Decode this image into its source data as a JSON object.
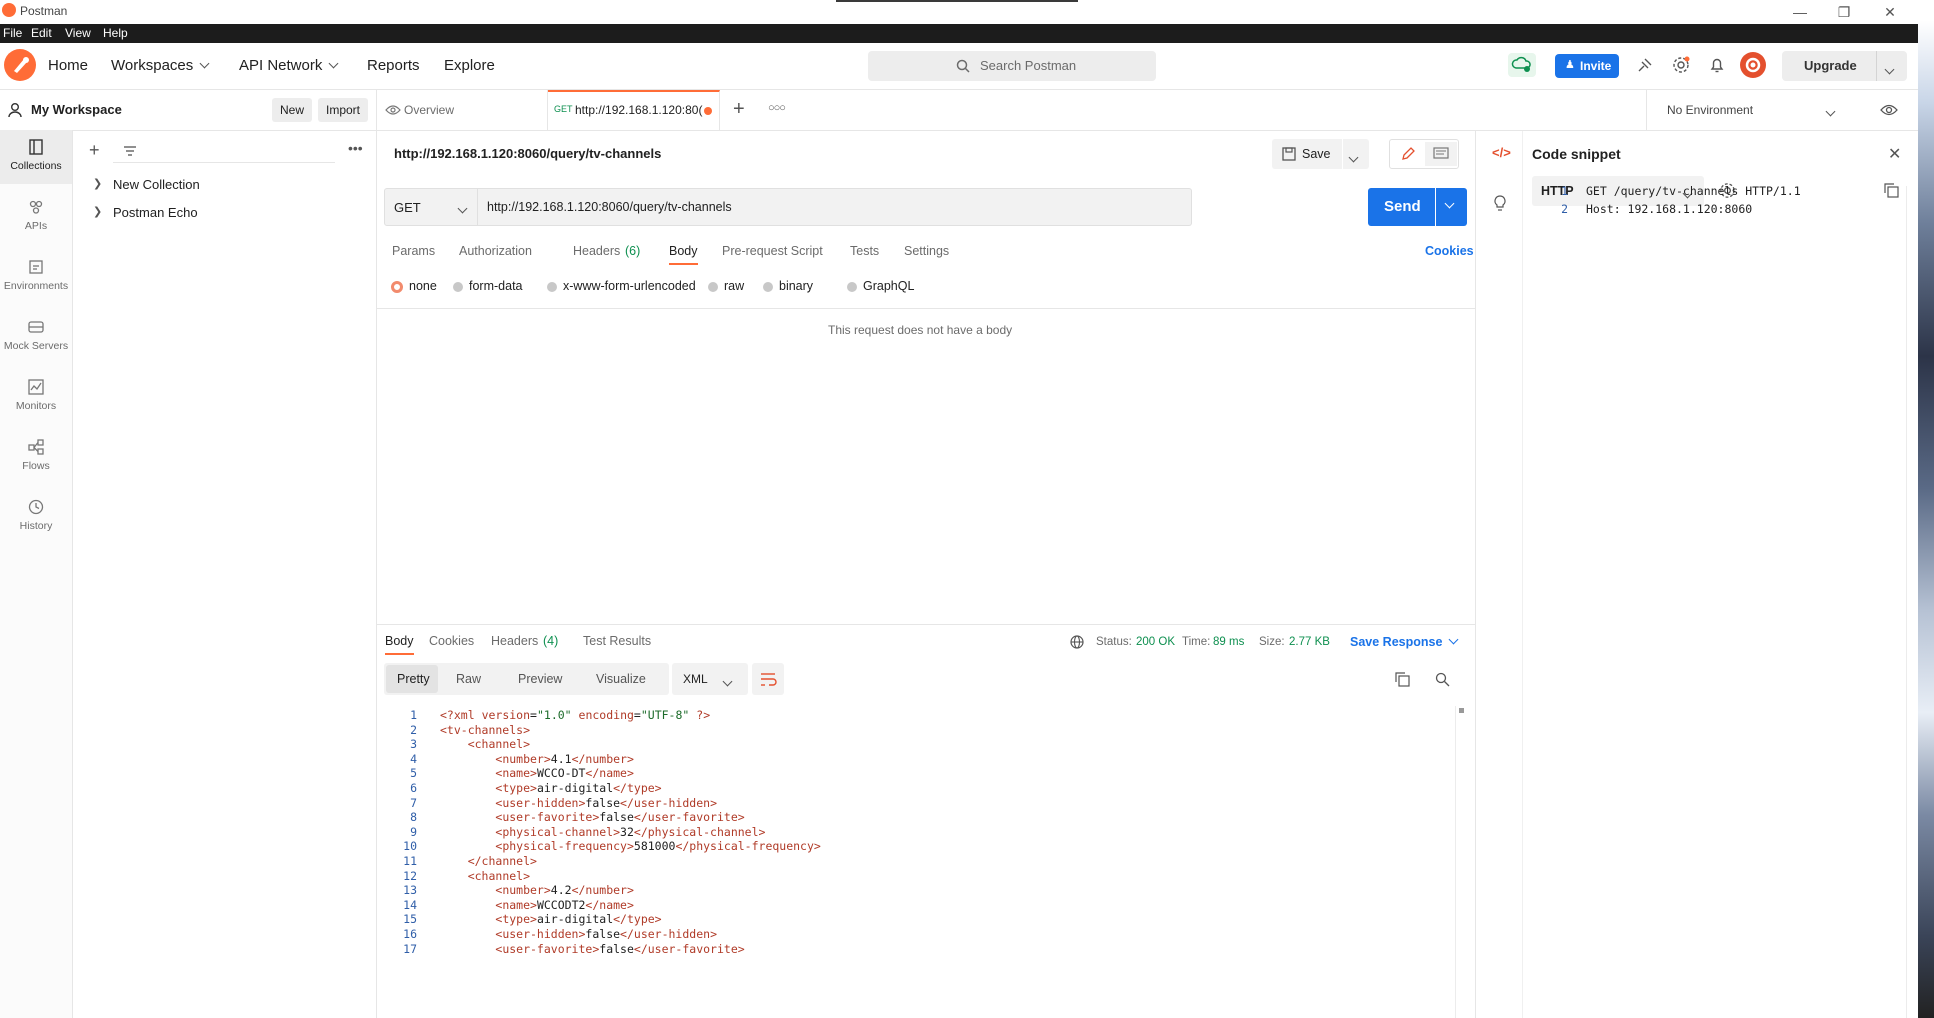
{
  "window": {
    "title": "Postman"
  },
  "menu": [
    "File",
    "Edit",
    "View",
    "Help"
  ],
  "header": {
    "nav": [
      "Home",
      "Workspaces",
      "API Network",
      "Reports",
      "Explore"
    ],
    "search_placeholder": "Search Postman",
    "invite_label": "Invite",
    "upgrade_label": "Upgrade"
  },
  "workspace": {
    "name": "My Workspace",
    "new_label": "New",
    "import_label": "Import"
  },
  "rail": [
    {
      "label": "Collections",
      "icon": "collections-icon"
    },
    {
      "label": "APIs",
      "icon": "apis-icon"
    },
    {
      "label": "Environments",
      "icon": "environments-icon"
    },
    {
      "label": "Mock Servers",
      "icon": "mock-servers-icon"
    },
    {
      "label": "Monitors",
      "icon": "monitors-icon"
    },
    {
      "label": "Flows",
      "icon": "flows-icon"
    },
    {
      "label": "History",
      "icon": "history-icon"
    }
  ],
  "collections": [
    "New Collection",
    "Postman Echo"
  ],
  "tabs": {
    "overview": "Overview",
    "active_method": "GET",
    "active_url": "http://192.168.1.120:80(",
    "environment": "No Environment"
  },
  "request": {
    "title": "http://192.168.1.120:8060/query/tv-channels",
    "save_label": "Save",
    "method": "GET",
    "url": "http://192.168.1.120:8060/query/tv-channels",
    "send_label": "Send",
    "tabs": [
      "Params",
      "Authorization",
      "Headers",
      "(6)",
      "Body",
      "Pre-request Script",
      "Tests",
      "Settings"
    ],
    "cookies_label": "Cookies",
    "body_types": [
      "none",
      "form-data",
      "x-www-form-urlencoded",
      "raw",
      "binary",
      "GraphQL"
    ],
    "no_body_message": "This request does not have a body"
  },
  "response": {
    "tabs": [
      "Body",
      "Cookies",
      "Headers",
      "(4)",
      "Test Results"
    ],
    "status_label": "Status:",
    "status_value": "200 OK",
    "time_label": "Time:",
    "time_value": "89 ms",
    "size_label": "Size:",
    "size_value": "2.77 KB",
    "save_response_label": "Save Response",
    "view_modes": [
      "Pretty",
      "Raw",
      "Preview",
      "Visualize"
    ],
    "format": "XML",
    "lines": [
      "<?xml version=\"1.0\" encoding=\"UTF-8\" ?>",
      "<tv-channels>",
      "    <channel>",
      "        <number>4.1</number>",
      "        <name>WCCO-DT</name>",
      "        <type>air-digital</type>",
      "        <user-hidden>false</user-hidden>",
      "        <user-favorite>false</user-favorite>",
      "        <physical-channel>32</physical-channel>",
      "        <physical-frequency>581000</physical-frequency>",
      "    </channel>",
      "    <channel>",
      "        <number>4.2</number>",
      "        <name>WCCODT2</name>",
      "        <type>air-digital</type>",
      "        <user-hidden>false</user-hidden>",
      "        <user-favorite>false</user-favorite>"
    ]
  },
  "snippet": {
    "title": "Code snippet",
    "language": "HTTP",
    "lines": [
      "GET /query/tv-channels HTTP/1.1",
      "Host: 192.168.1.120:8060"
    ]
  },
  "colors": {
    "accent": "#ff6c37",
    "send": "#1a73e8",
    "status_ok": "#0d8f4f"
  }
}
